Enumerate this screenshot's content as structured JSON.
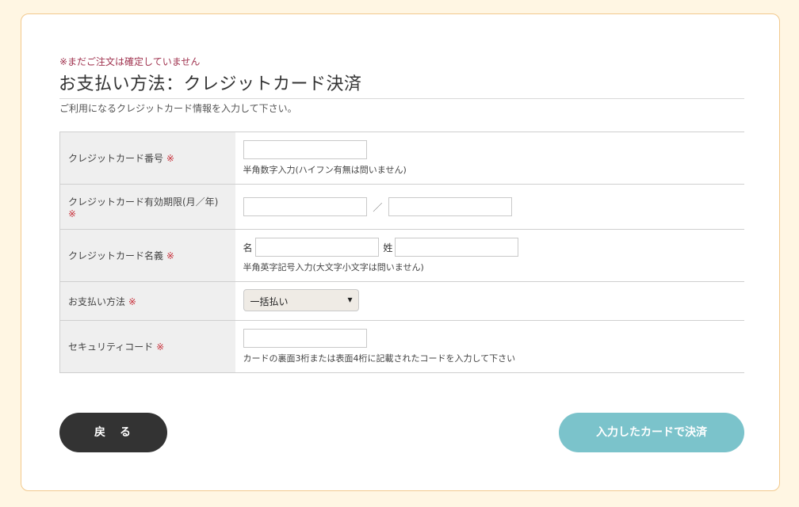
{
  "notice": "※まだご注文は確定していません",
  "title": "お支払い方法：クレジットカード決済",
  "subtitle": "ご利用になるクレジットカード情報を入力して下さい。",
  "required_mark": "※",
  "rows": {
    "card_number": {
      "label": "クレジットカード番号",
      "value": "",
      "help": "半角数字入力(ハイフン有無は問いません)"
    },
    "expiry": {
      "label": "クレジットカード有効期限(月／年)",
      "month_value": "",
      "year_value": "",
      "separator": "／"
    },
    "card_name": {
      "label": "クレジットカード名義",
      "first_label": "名",
      "last_label": "姓",
      "first_value": "",
      "last_value": "",
      "help": "半角英字記号入力(大文字小文字は問いません)"
    },
    "payment_method": {
      "label": "お支払い方法",
      "selected": "一括払い"
    },
    "security_code": {
      "label": "セキュリティコード",
      "value": "",
      "help": "カードの裏面3桁または表面4桁に記載されたコードを入力して下さい"
    }
  },
  "buttons": {
    "back": "戻　る",
    "pay": "入力したカードで決済"
  },
  "colors": {
    "page_bg": "#fff6e3",
    "card_border": "#f2c98d",
    "notice": "#a0334f",
    "required": "#c8323c",
    "header_cell": "#efefef",
    "back_button": "#333333",
    "pay_button": "#7bc3cb"
  },
  "icons": {
    "select_arrow": "chevron-down-icon"
  }
}
